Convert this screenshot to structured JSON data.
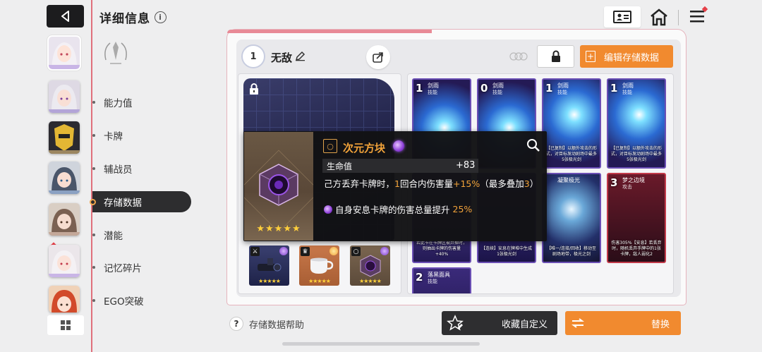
{
  "header": {
    "title": "详细信息",
    "info_icon": "info-icon",
    "back_icon": "back-arrow-icon"
  },
  "top_right": {
    "profile_icon": "id-card-icon",
    "home_icon": "home-icon",
    "menu_icon": "menu-icon"
  },
  "nav": {
    "items": [
      {
        "label": "能力值",
        "active": false
      },
      {
        "label": "卡牌",
        "active": false
      },
      {
        "label": "辅战员",
        "active": false
      },
      {
        "label": "存储数据",
        "active": true
      },
      {
        "label": "潜能",
        "active": false
      },
      {
        "label": "记忆碎片",
        "active": false
      },
      {
        "label": "EGO突破",
        "active": false
      }
    ]
  },
  "deck": {
    "level": "1",
    "name": "无敌",
    "lock_icon": "lock-icon",
    "edit_label": "编辑存储数据"
  },
  "tooltip": {
    "title": "次元方块",
    "stat_label": "生命值",
    "stat_value": "+83",
    "desc_a": "己方丢弃卡牌时，",
    "desc_b": "1",
    "desc_c": "回合内伤害量",
    "desc_d": "+15%",
    "desc_e": "（最多叠加",
    "desc_f": "3",
    "desc_g": "）",
    "desc2_a": "自身安息卡牌的伤害总量提升",
    "desc2_b": "25%",
    "stars": "★★★★★"
  },
  "cards": [
    {
      "cost": "1",
      "name": "剑雨",
      "type": "技能",
      "desc": ""
    },
    {
      "cost": "0",
      "name": "剑雨",
      "type": "技能",
      "desc": ""
    },
    {
      "cost": "1",
      "name": "剑雨",
      "type": "技能",
      "desc": "【已复制】以额外攻击的形式，对目标发动剧场中最多5张极光剑"
    },
    {
      "cost": "1",
      "name": "剑雨",
      "type": "技能",
      "desc": "【已复制】以额外攻击的形式，对目标发动剧场中最多5张极光剑"
    },
    {
      "cost": "",
      "name": "",
      "type": "",
      "desc": "若此卡在卡牌区被弃掉时，则抽出卡牌的伤害量+40%"
    },
    {
      "cost": "",
      "name": "",
      "type": "",
      "desc": "【连续】安息在牌堆中生成1张极光剑"
    },
    {
      "cost": "",
      "name": "凝聚极光",
      "type": "",
      "desc": "【唯一/连接/回收】移动至剧场地带，极光之剑"
    },
    {
      "cost": "3",
      "name": "梦之边境",
      "type": "攻击",
      "desc": "伤害305%【安息】若丢弃时，随机丢弃手牌中的1张卡牌，敌人弱化2"
    },
    {
      "cost": "2",
      "name": "落黑面具",
      "type": "技能",
      "desc": ""
    }
  ],
  "bottom": {
    "help_label": "存储数据帮助",
    "fav_label": "收藏自定义",
    "replace_label": "替换"
  },
  "colors": {
    "accent": "#f18a2f",
    "nav_active": "#2d2d2f",
    "tooltip_title": "#f2a33a",
    "side_line": "#e0707c"
  }
}
